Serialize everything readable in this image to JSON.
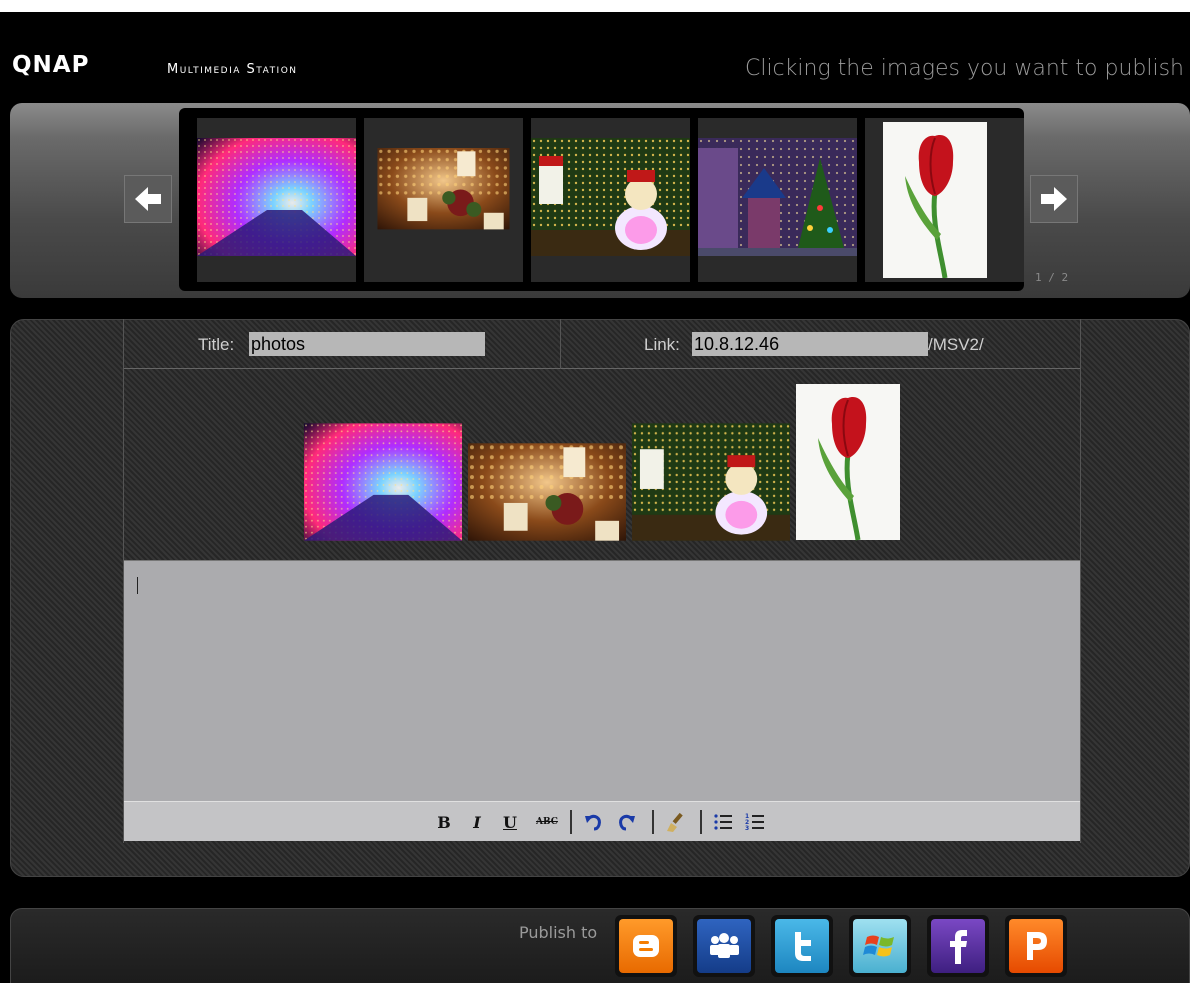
{
  "header": {
    "logo": "QNAP",
    "product": "Multimedia Station",
    "hint": "Clicking the images you want to publish"
  },
  "carousel": {
    "page_indicator": "1 / 2",
    "thumbnails": [
      {
        "name": "light-tunnel-photo"
      },
      {
        "name": "candles-bouquet-photo"
      },
      {
        "name": "snowman-lights-photo"
      },
      {
        "name": "christmas-house-photo"
      },
      {
        "name": "red-tulip-photo"
      }
    ]
  },
  "form": {
    "title_label": "Title:",
    "title_value": "photos",
    "link_label": "Link:",
    "link_value": "10.8.12.46",
    "link_suffix": "/MSV2/"
  },
  "editor": {
    "text": "",
    "toolbar": {
      "bold": "B",
      "italic": "I",
      "underline": "U",
      "strike": "ABC"
    }
  },
  "publish": {
    "label": "Publish to",
    "services": [
      {
        "name": "blogger",
        "letter": "B",
        "color": "#f57d00"
      },
      {
        "name": "myspace",
        "color": "#1e4fa0"
      },
      {
        "name": "twitter",
        "letter": "t",
        "color": "#2a9fd6"
      },
      {
        "name": "windows-live",
        "color": "#6fc6e0"
      },
      {
        "name": "facebook",
        "letter": "f",
        "color": "#5b2fa0"
      },
      {
        "name": "plurk",
        "letter": "P",
        "color": "#f05a00"
      }
    ]
  }
}
